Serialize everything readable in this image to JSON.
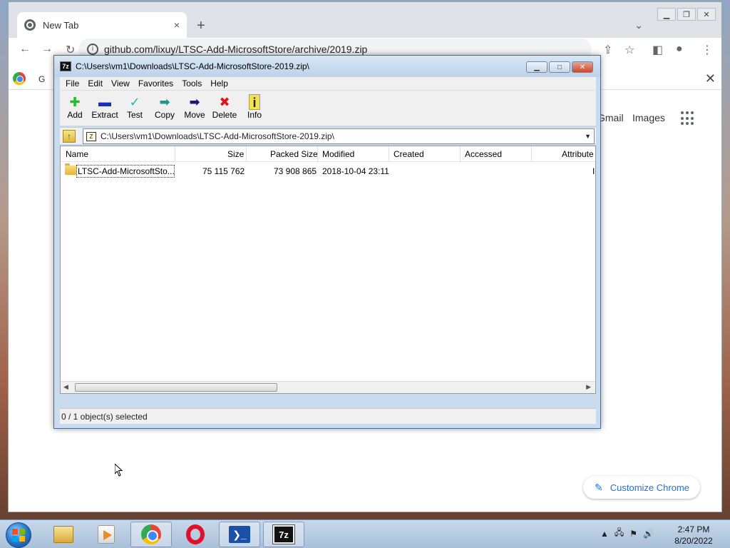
{
  "chrome": {
    "tab_title": "New Tab",
    "tab_close": "×",
    "new_tab": "+",
    "tab_list": "⌄",
    "address": "github.com/lixuy/LTSC-Add-MicrosoftStore/archive/2019.zip",
    "bookmark_text": "G",
    "gmail": "Gmail",
    "images": "Images",
    "customize": "Customize Chrome",
    "bar_close": "✕"
  },
  "zip": {
    "title": "C:\\Users\\vm1\\Downloads\\LTSC-Add-MicrosoftStore-2019.zip\\",
    "app_icon": "7z",
    "menu": [
      "File",
      "Edit",
      "View",
      "Favorites",
      "Tools",
      "Help"
    ],
    "tools": [
      {
        "label": "Add",
        "glyph": "✚",
        "color": "#1fbf2a"
      },
      {
        "label": "Extract",
        "glyph": "▬",
        "color": "#1a2fb8"
      },
      {
        "label": "Test",
        "glyph": "✓",
        "color": "#19b8b8"
      },
      {
        "label": "Copy",
        "glyph": "➡",
        "color": "#1a9a8a"
      },
      {
        "label": "Move",
        "glyph": "➡",
        "color": "#101a80"
      },
      {
        "label": "Delete",
        "glyph": "✖",
        "color": "#e0141a"
      },
      {
        "label": "Info",
        "glyph": "i",
        "color": "#222"
      }
    ],
    "address": "C:\\Users\\vm1\\Downloads\\LTSC-Add-MicrosoftStore-2019.zip\\",
    "columns": [
      "Name",
      "Size",
      "Packed Size",
      "Modified",
      "Created",
      "Accessed",
      "Attribute"
    ],
    "rows": [
      {
        "name": "LTSC-Add-MicrosoftSto...",
        "size": "75 115 762",
        "packed": "73 908 865",
        "modified": "2018-10-04 23:11",
        "created": "",
        "accessed": "",
        "attr": "I"
      }
    ],
    "status": "0 / 1 object(s) selected"
  },
  "taskbar": {
    "ps_label": "❯_",
    "sz_label": "7z",
    "time": "2:47 PM",
    "date": "8/20/2022"
  },
  "colors": {
    "accent": "#1a73e8",
    "close_red": "#c7482e"
  }
}
